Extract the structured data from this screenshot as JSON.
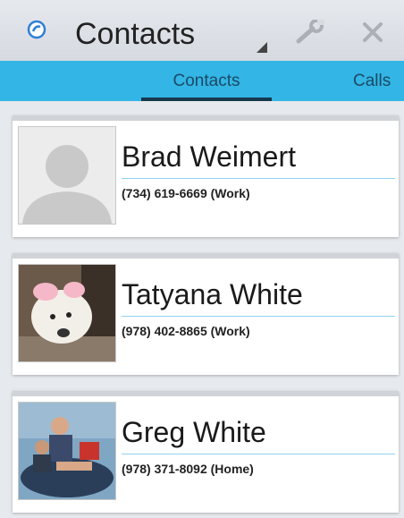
{
  "titlebar": {
    "title": "Contacts",
    "icons": [
      "app-badge-icon",
      "resize-corner-icon",
      "wrench-icon",
      "close-icon"
    ]
  },
  "tabs": [
    {
      "label": "Contacts",
      "selected": true
    },
    {
      "label": "Calls",
      "selected": false
    }
  ],
  "contacts": [
    {
      "name": "Brad Weimert",
      "phone": "(734) 619-6669 (Work)",
      "photo": "placeholder-avatar"
    },
    {
      "name": "Tatyana White",
      "phone": "(978) 402-8865 (Work)",
      "photo": "dog-photo"
    },
    {
      "name": "Greg White",
      "phone": "(978) 371-8092 (Home)",
      "photo": "family-photo"
    }
  ],
  "colors": {
    "tabbar": "#33b5e5",
    "tab_indicator": "#15384d",
    "divider": "#8fd3ee",
    "background": "#e6e9ed"
  }
}
